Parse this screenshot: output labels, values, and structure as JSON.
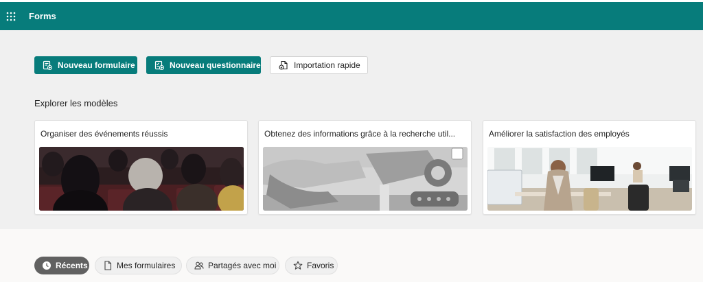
{
  "header": {
    "app_title": "Forms",
    "bar_color": "#077c7b",
    "launcher_icon": "waffle-icon"
  },
  "actions": {
    "new_form_label": "Nouveau formulaire",
    "new_quiz_label": "Nouveau questionnaire",
    "quick_import_label": "Importation rapide"
  },
  "templates": {
    "section_title": "Explorer les modèles",
    "cards": [
      {
        "title": "Organiser des événements réussis"
      },
      {
        "title": "Obtenez des informations grâce à la recherche util..."
      },
      {
        "title": "Améliorer la satisfaction des employés"
      }
    ]
  },
  "filters": {
    "recents_label": "Récents",
    "my_forms_label": "Mes formulaires",
    "shared_label": "Partagés avec moi",
    "favorites_label": "Favoris",
    "active": "Récents"
  }
}
